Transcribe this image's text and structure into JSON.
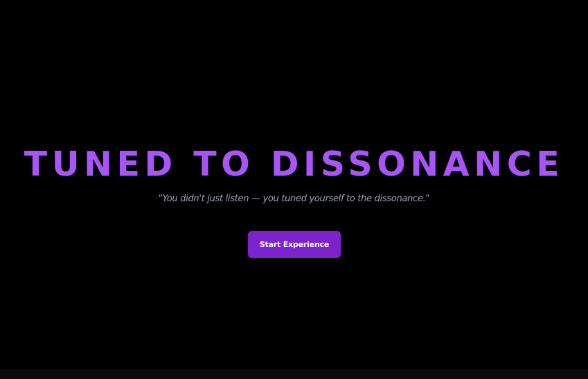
{
  "hero": {
    "title": "TUNED TO DISSONANCE",
    "quote": "\"You didn't just listen — you tuned yourself to the dissonance.\"",
    "cta_label": "Start Experience"
  },
  "colors": {
    "background": "#000000",
    "title": "#a855f7",
    "quote": "#9ca3af",
    "button": "#7e22ce"
  }
}
